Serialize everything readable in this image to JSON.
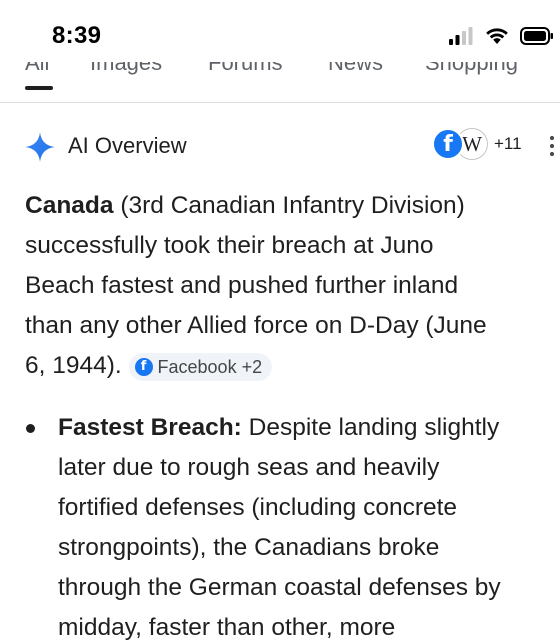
{
  "status_bar": {
    "time": "8:39",
    "icons": [
      "cellular-signal-icon",
      "wifi-icon",
      "battery-icon"
    ]
  },
  "tabs": [
    {
      "label": "All",
      "active": true
    },
    {
      "label": "Images",
      "active": false
    },
    {
      "label": "Forums",
      "active": false
    },
    {
      "label": "News",
      "active": false
    },
    {
      "label": "Shopping",
      "active": false
    }
  ],
  "ai_overview": {
    "title": "AI Overview",
    "source_more": "+11",
    "summary_bold": "Canada",
    "summary_lines": [
      " (3rd Canadian Infantry Division)",
      "successfully took their breach at Juno",
      "Beach fastest and pushed further inland",
      "than any other Allied force on D-Day (June",
      "6, 1944). "
    ],
    "summary_chip": "Facebook +2",
    "bullets": [
      {
        "heading": "Fastest Breach:",
        "lines": [
          " Despite landing slightly",
          "later due to rough seas and heavily",
          "fortified defenses (including concrete",
          "strongpoints), the Canadians broke",
          "through the German coastal defenses by",
          "midday, faster than other, more"
        ]
      }
    ]
  },
  "colors": {
    "google_blue": "#1a73e8",
    "facebook_blue": "#1877f2",
    "text": "#1f1f1f"
  }
}
